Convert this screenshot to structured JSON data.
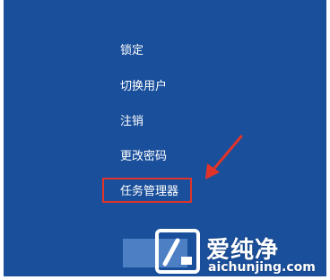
{
  "menu": {
    "items": [
      {
        "label": "锁定"
      },
      {
        "label": "切换用户"
      },
      {
        "label": "注销"
      },
      {
        "label": "更改密码"
      },
      {
        "label": "任务管理器"
      }
    ],
    "highlighted_item": "任务管理器"
  },
  "colors": {
    "background": "#1a4f9b",
    "text": "#ffffff",
    "highlight_border": "#e0342b",
    "arrow": "#e0342b",
    "button": "#4d7fc4"
  },
  "watermark": {
    "brand_cn": "爱纯净",
    "url": "aichunjing.com",
    "icon": "aichunjing-logo"
  }
}
